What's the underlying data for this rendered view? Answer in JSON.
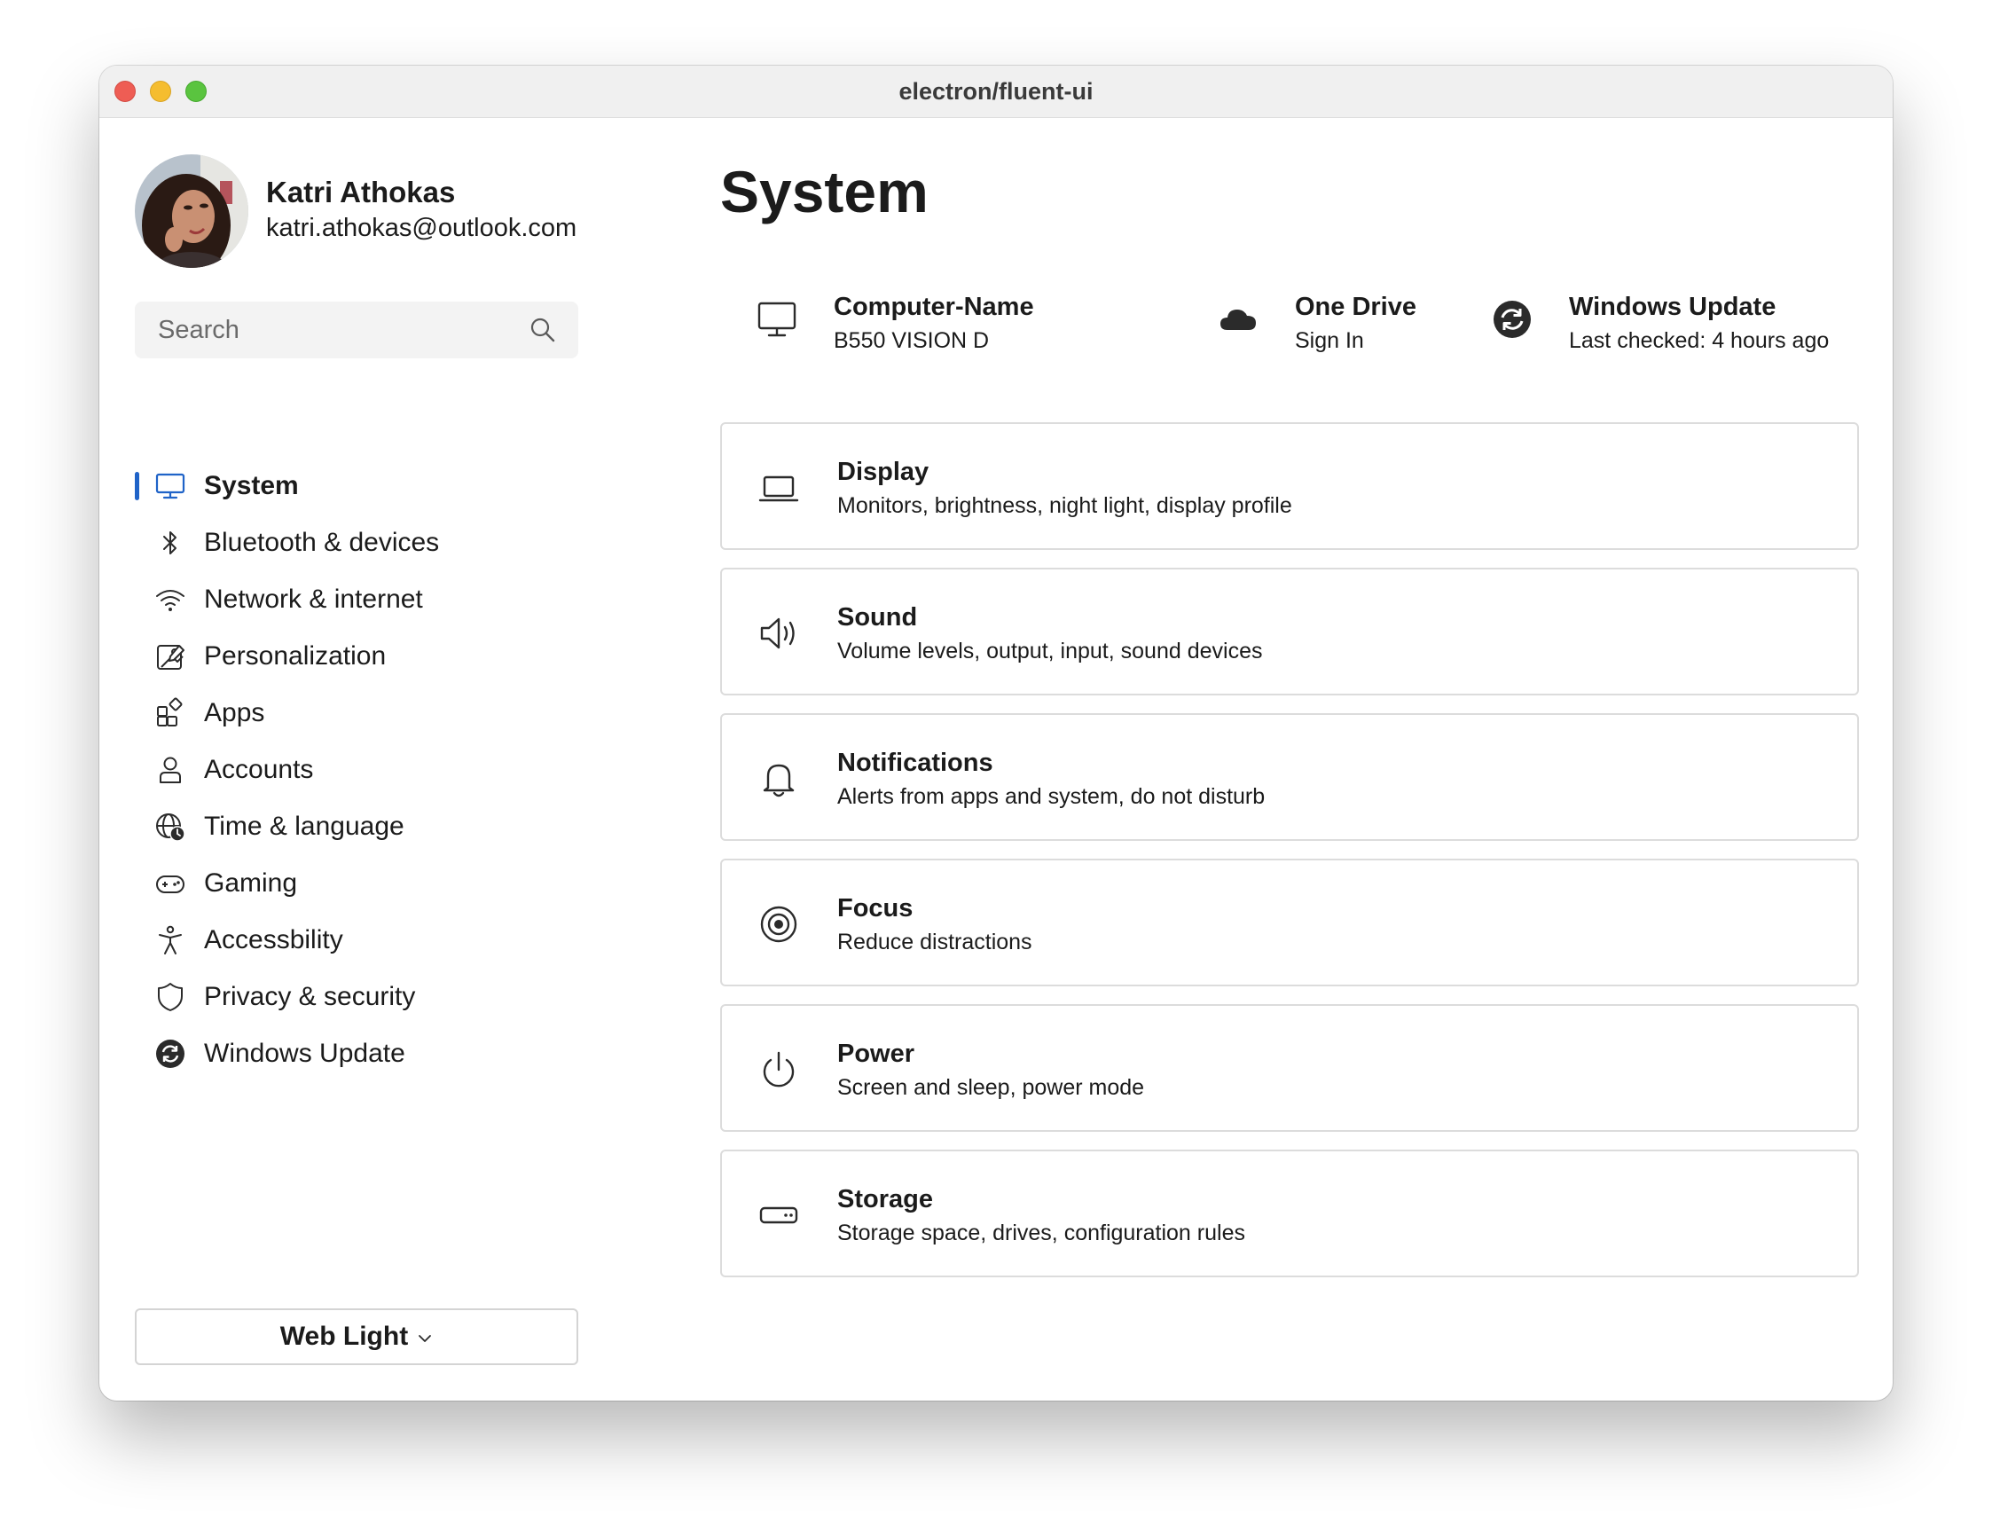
{
  "window": {
    "title": "electron/fluent-ui"
  },
  "profile": {
    "name": "Katri Athokas",
    "email": "katri.athokas@outlook.com",
    "avatar": "avatar-photo"
  },
  "search": {
    "placeholder": "Search",
    "icon": "search-icon"
  },
  "sidebar": {
    "items": [
      {
        "label": "System",
        "icon": "monitor-icon",
        "active": true
      },
      {
        "label": "Bluetooth & devices",
        "icon": "bluetooth-icon"
      },
      {
        "label": "Network & internet",
        "icon": "wifi-icon"
      },
      {
        "label": "Personalization",
        "icon": "paint-brush-icon"
      },
      {
        "label": "Apps",
        "icon": "apps-grid-icon"
      },
      {
        "label": "Accounts",
        "icon": "person-icon"
      },
      {
        "label": "Time & language",
        "icon": "globe-clock-icon"
      },
      {
        "label": "Gaming",
        "icon": "gamepad-icon"
      },
      {
        "label": "Accessbility",
        "icon": "accessibility-icon"
      },
      {
        "label": "Privacy & security",
        "icon": "shield-icon"
      },
      {
        "label": "Windows Update",
        "icon": "update-sync-icon"
      }
    ]
  },
  "theme_selector": {
    "label": "Web Light",
    "icon": "chevron-down-icon"
  },
  "main": {
    "title": "System",
    "info": [
      {
        "title": "Computer-Name",
        "subtitle": "B550 VISION D",
        "icon": "monitor-icon"
      },
      {
        "title": "One Drive",
        "subtitle": "Sign In",
        "icon": "cloud-icon"
      },
      {
        "title": "Windows Update",
        "subtitle": "Last checked: 4 hours ago",
        "icon": "update-sync-icon"
      }
    ],
    "cards": [
      {
        "title": "Display",
        "subtitle": "Monitors, brightness, night light, display profile",
        "icon": "laptop-icon"
      },
      {
        "title": "Sound",
        "subtitle": "Volume levels, output, input, sound devices",
        "icon": "speaker-icon"
      },
      {
        "title": "Notifications",
        "subtitle": "Alerts from apps and system, do not disturb",
        "icon": "bell-icon"
      },
      {
        "title": "Focus",
        "subtitle": "Reduce distractions",
        "icon": "focus-target-icon"
      },
      {
        "title": "Power",
        "subtitle": "Screen and sleep, power mode",
        "icon": "power-icon"
      },
      {
        "title": "Storage",
        "subtitle": "Storage space, drives, configuration rules",
        "icon": "storage-drive-icon"
      }
    ]
  },
  "colors": {
    "accent": "#1f63c8",
    "text": "#1b1b1b",
    "card_border": "#dcdcdc",
    "search_bg": "#f3f3f3",
    "titlebar_bg": "#f0f0f0"
  }
}
